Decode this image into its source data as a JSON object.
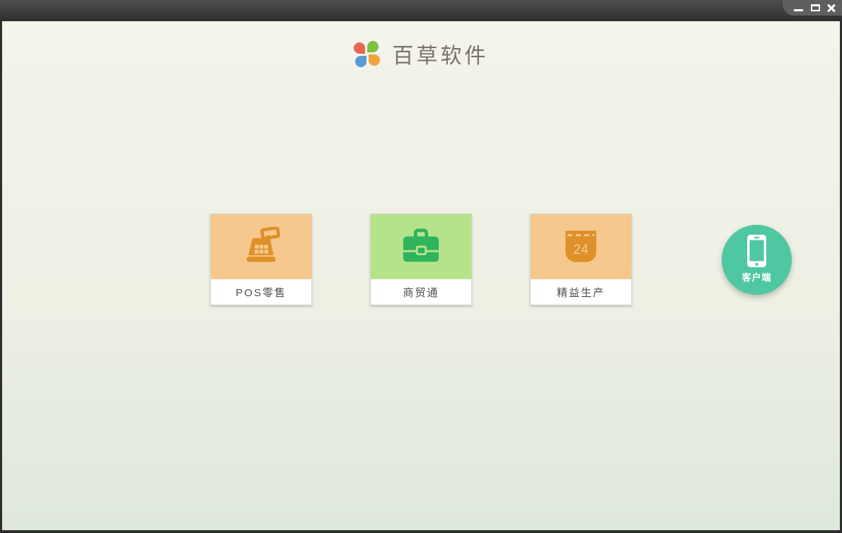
{
  "window": {
    "controls": [
      {
        "name": "minimize",
        "icon": "minimize-icon"
      },
      {
        "name": "maximize",
        "icon": "maximize-icon"
      },
      {
        "name": "close",
        "icon": "close-icon"
      }
    ]
  },
  "header": {
    "app_name": "百草软件",
    "logo_icon": "pinwheel-icon"
  },
  "products": [
    {
      "label": "POS零售",
      "icon": "cash-register-icon",
      "tile_color": "#f6c88e",
      "icon_color": "#de9029"
    },
    {
      "label": "商贸通",
      "icon": "briefcase-icon",
      "tile_color": "#b5e38b",
      "icon_color": "#2fb35b"
    },
    {
      "label": "精益生产",
      "icon": "calendar-icon",
      "calendar_day": "24",
      "tile_color": "#f6c88e",
      "icon_color": "#de9029"
    }
  ],
  "client_button": {
    "label": "客户端",
    "icon": "smartphone-icon",
    "color": "#4fc7a2"
  },
  "colors": {
    "titlebar_top": "#4e4e4e",
    "titlebar_bottom": "#2f2f2f",
    "background_top": "#f4f3ec",
    "background_bottom": "#dfe8dc",
    "card_label_text": "#4d4d4d",
    "brand_text": "#76746a"
  }
}
